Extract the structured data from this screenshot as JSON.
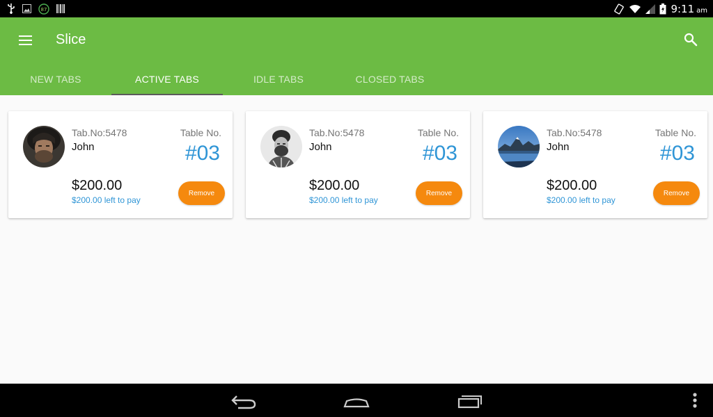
{
  "status_bar": {
    "time": "9:11",
    "ampm": "am",
    "badge": "87"
  },
  "app_bar": {
    "title": "Slice"
  },
  "tabs": [
    {
      "label": "NEW TABS",
      "active": false
    },
    {
      "label": "ACTIVE TABS",
      "active": true
    },
    {
      "label": "IDLE TABS",
      "active": false
    },
    {
      "label": "CLOSED TABS",
      "active": false
    }
  ],
  "cards": [
    {
      "tab_no": "Tab.No:5478",
      "name": "John",
      "table_label": "Table No.",
      "table_num": "#03",
      "amount": "$200.00",
      "left_to_pay": "$200.00 left to pay",
      "remove_label": "Remove",
      "avatar": "man-portrait-dark"
    },
    {
      "tab_no": "Tab.No:5478",
      "name": "John",
      "table_label": "Table No.",
      "table_num": "#03",
      "amount": "$200.00",
      "left_to_pay": "$200.00 left to pay",
      "remove_label": "Remove",
      "avatar": "man-portrait-bw"
    },
    {
      "tab_no": "Tab.No:5478",
      "name": "John",
      "table_label": "Table No.",
      "table_num": "#03",
      "amount": "$200.00",
      "left_to_pay": "$200.00 left to pay",
      "remove_label": "Remove",
      "avatar": "mountain-lake"
    }
  ],
  "colors": {
    "app_bar": "#6cbb44",
    "accent_blue": "#2f95d6",
    "remove_orange": "#f5890e"
  }
}
